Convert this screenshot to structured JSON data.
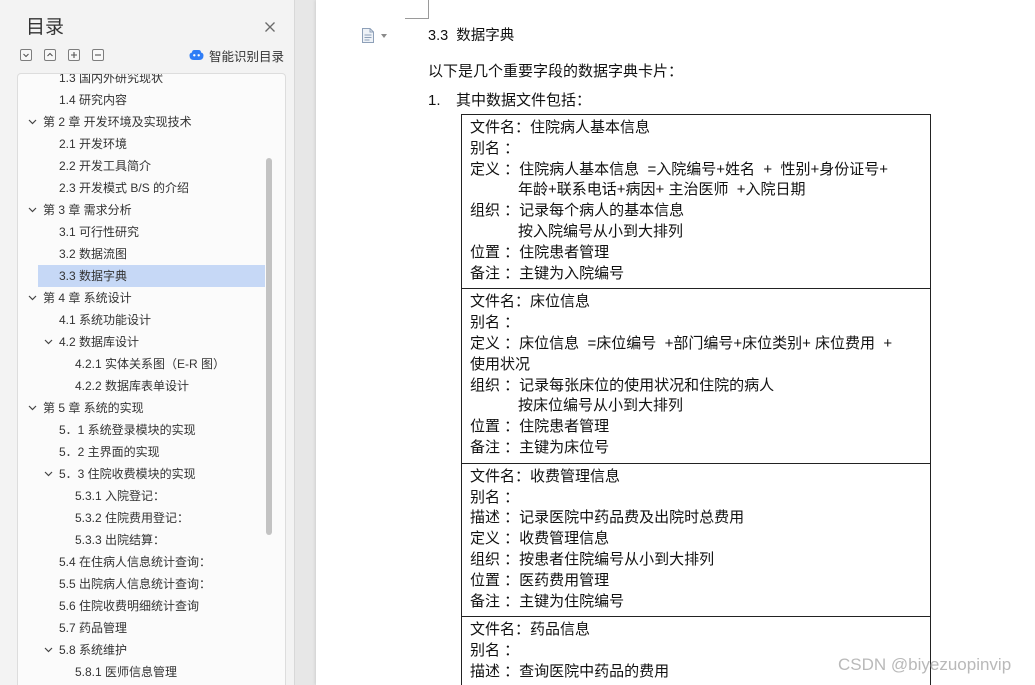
{
  "toc": {
    "title": "目录",
    "close_icon": "close-icon",
    "toolbar_icons": [
      "chevron-down-square-icon",
      "chevron-up-square-icon",
      "plus-square-icon",
      "minus-square-icon"
    ],
    "smart_detect": {
      "icon": "smart-detect-icon",
      "label": "智能识别目录"
    },
    "items": [
      {
        "label": "1.3 国内外研究现状"
      },
      {
        "label": "1.4 研究内容"
      },
      {
        "label": "第 2 章  开发环境及实现技术",
        "expanded": true
      },
      {
        "label": "2.1 开发环境"
      },
      {
        "label": "2.2 开发工具简介"
      },
      {
        "label": "2.3 开发模式 B/S 的介绍"
      },
      {
        "label": "第 3 章  需求分析",
        "expanded": true
      },
      {
        "label": "3.1 可行性研究"
      },
      {
        "label": "3.2  数据流图"
      },
      {
        "label": "3.3  数据字典",
        "selected": true
      },
      {
        "label": "第 4 章  系统设计",
        "expanded": true
      },
      {
        "label": "4.1 系统功能设计"
      },
      {
        "label": "4.2  数据库设计",
        "expanded": true
      },
      {
        "label": "4.2.1 实体关系图（E-R 图）"
      },
      {
        "label": "4.2.2 数据库表单设计"
      },
      {
        "label": "第 5 章  系统的实现",
        "expanded": true
      },
      {
        "label": "5．1 系统登录模块的实现"
      },
      {
        "label": "5．2 主界面的实现"
      },
      {
        "label": "5．3 住院收费模块的实现",
        "expanded": true
      },
      {
        "label": "5.3.1 入院登记："
      },
      {
        "label": "5.3.2 住院费用登记："
      },
      {
        "label": "5.3.3 出院结算："
      },
      {
        "label": "5.4 在住病人信息统计查询："
      },
      {
        "label": "5.5 出院病人信息统计查询："
      },
      {
        "label": "5.6 住院收费明细统计查询"
      },
      {
        "label": "5.7 药品管理"
      },
      {
        "label": "5.8 系统维护",
        "expanded": true
      },
      {
        "label": "5.8.1 医师信息管理"
      }
    ]
  },
  "document": {
    "icon": "document-icon",
    "heading": "3.3  数据字典",
    "intro": "以下是几个重要字段的数据字典卡片：",
    "list_marker": "1.",
    "list_text": "其中数据文件包括：",
    "cards": [
      {
        "lines": [
          "文件名：住院病人基本信息",
          "别名 ：",
          "定义 ：住院病人基本信息  =入院编号+姓名  +  性别+身份证号+",
          "年龄+联系电话+病因+ 主治医师  +入院日期",
          "组织 ：记录每个病人的基本信息",
          "按入院编号从小到大排列",
          "位置 ：住院患者管理",
          "备注 ：主键为入院编号"
        ]
      },
      {
        "lines": [
          "文件名：床位信息",
          "别名 ：",
          "定义 ：床位信息  =床位编号  +部门编号+床位类别+ 床位费用  +",
          "使用状况",
          "组织 ：记录每张床位的使用状况和住院的病人",
          "按床位编号从小到大排列",
          "位置 ：住院患者管理",
          "备注 ：主键为床位号"
        ]
      },
      {
        "lines": [
          "文件名：收费管理信息",
          "别名 ：",
          "描述 ：记录医院中药品费及出院时总费用",
          "定义 ：收费管理信息",
          "组织 ：按患者住院编号从小到大排列",
          "位置 ：医药费用管理",
          "备注 ：主键为住院编号"
        ]
      },
      {
        "lines": [
          "文件名：药品信息",
          "别名 ：",
          "描述 ：查询医院中药品的费用"
        ]
      }
    ]
  },
  "watermark": "CSDN @biyezuopinvip",
  "colors": {
    "selected_row": "#c6d8f6",
    "smart_icon": "#2f7df6",
    "table_border": "#222222",
    "watermark": "#b9b9b9"
  }
}
